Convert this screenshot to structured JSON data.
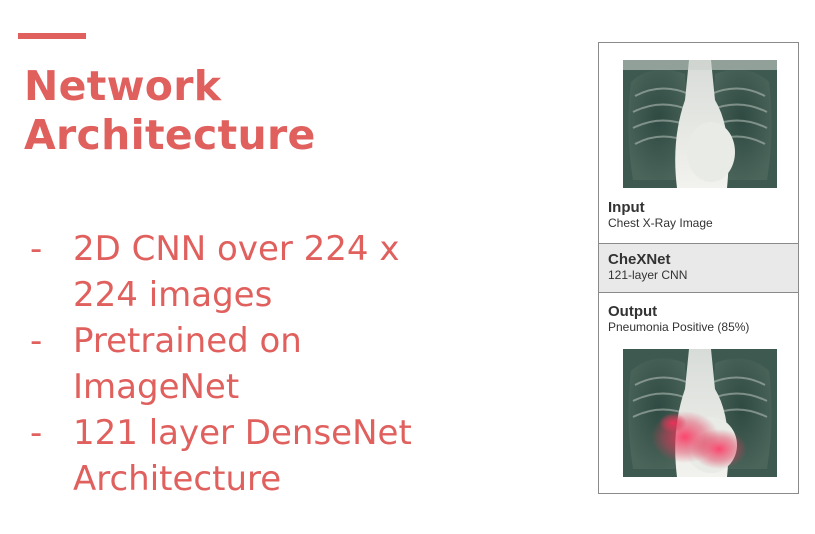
{
  "slide": {
    "title_line1": "Network",
    "title_line2": "Architecture",
    "accent_color": "#e0605e",
    "bullets": [
      {
        "dash": "-",
        "line1": "2D CNN over 224 x",
        "line2": "224 images"
      },
      {
        "dash": "-",
        "line1": "Pretrained on",
        "line2": "ImageNet"
      },
      {
        "dash": "-",
        "line1": "121 layer DenseNet",
        "line2": "Architecture"
      }
    ]
  },
  "figure": {
    "input_label": "Input",
    "input_sub": "Chest X-Ray Image",
    "model_label": "CheXNet",
    "model_sub": "121-layer CNN",
    "output_label": "Output",
    "output_sub": "Pneumonia Positive (85%)",
    "output_confidence_pct": 85,
    "heatmap_color": "#e23a5a"
  }
}
